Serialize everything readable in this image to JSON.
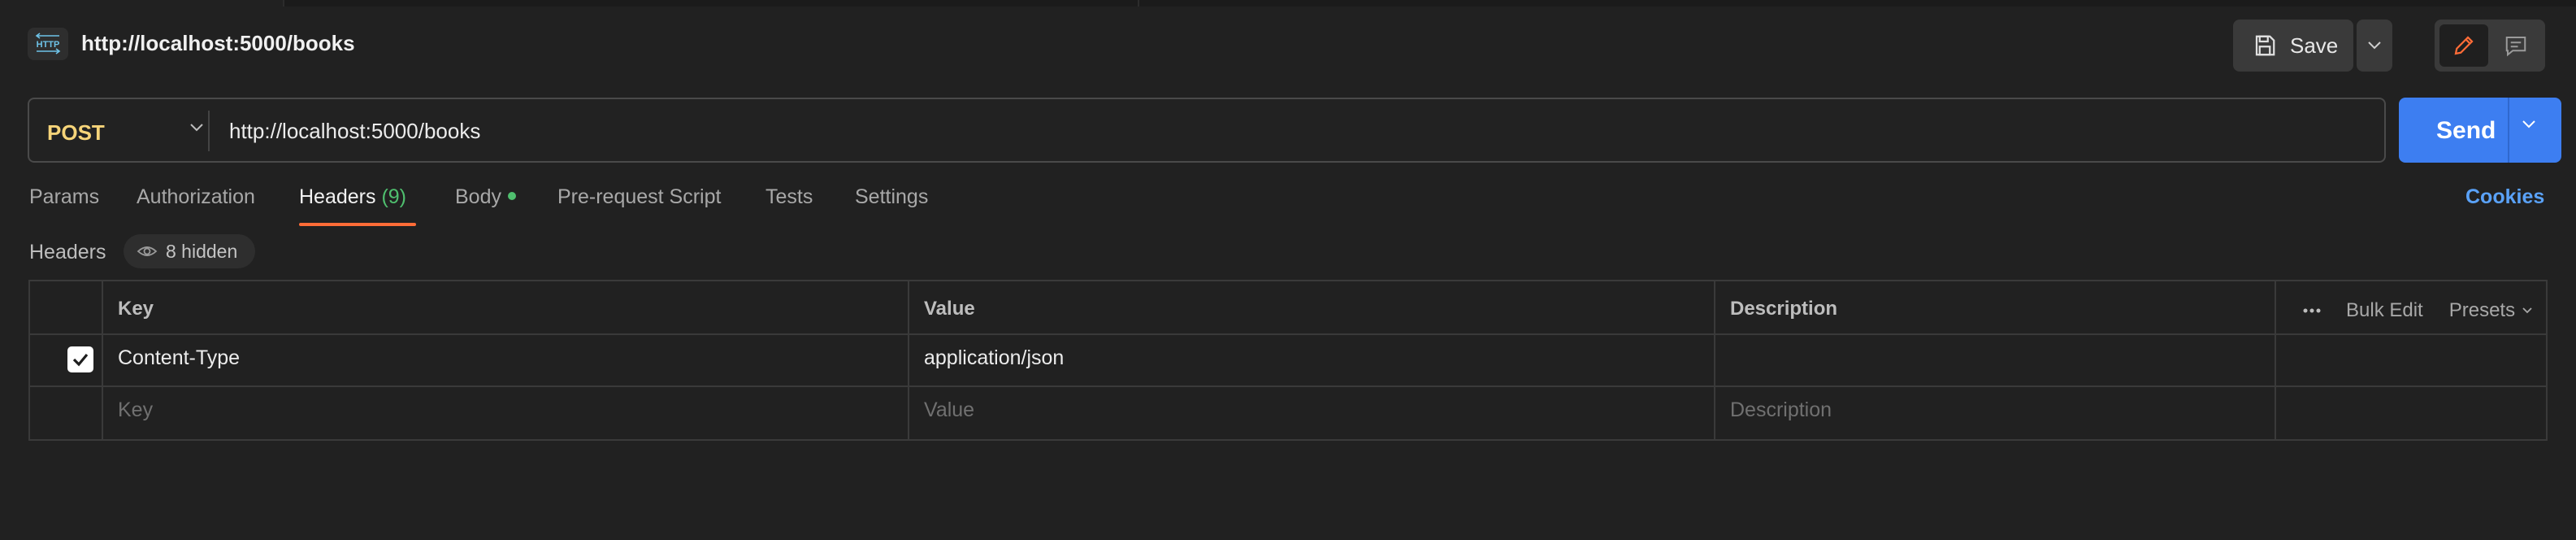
{
  "request": {
    "icon_label": "HTTP",
    "title": "http://localhost:5000/books",
    "save_label": "Save",
    "method": "POST",
    "url": "http://localhost:5000/books",
    "send_label": "Send"
  },
  "tabs": [
    {
      "label": "Params",
      "active": false
    },
    {
      "label": "Authorization",
      "active": false
    },
    {
      "label": "Headers",
      "count": "(9)",
      "active": true
    },
    {
      "label": "Body",
      "has_dot": true,
      "active": false
    },
    {
      "label": "Pre-request Script",
      "active": false
    },
    {
      "label": "Tests",
      "active": false
    },
    {
      "label": "Settings",
      "active": false
    }
  ],
  "cookies_label": "Cookies",
  "headers_section": {
    "label": "Headers",
    "hidden_label": "8 hidden",
    "columns": {
      "key": "Key",
      "value": "Value",
      "description": "Description"
    },
    "actions": {
      "bulk_edit": "Bulk Edit",
      "presets": "Presets"
    },
    "rows": [
      {
        "checked": true,
        "key": "Content-Type",
        "value": "application/json",
        "description": ""
      }
    ],
    "placeholders": {
      "key": "Key",
      "value": "Value",
      "description": "Description"
    }
  },
  "colors": {
    "background": "#212121",
    "accent_tab": "#ff6c37",
    "method": "#f6d479",
    "send": "#3d7ef1",
    "link": "#5aa2f8",
    "count": "#4fbf6e"
  }
}
